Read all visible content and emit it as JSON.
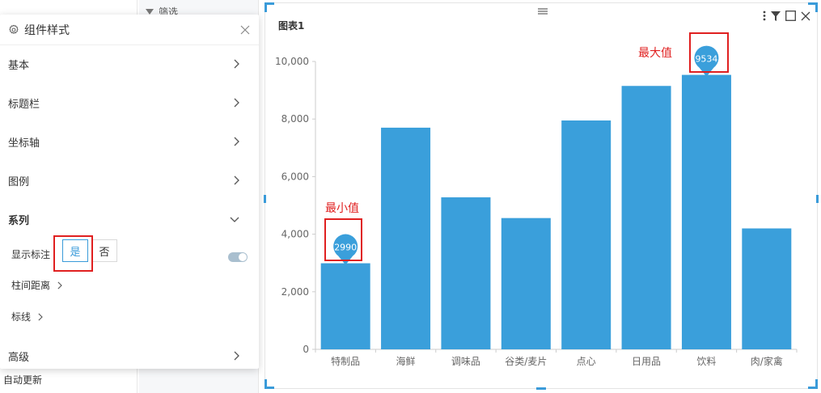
{
  "background": {
    "filter_label": "筛选",
    "auto_update_label": "自动更新"
  },
  "panel": {
    "title": "组件样式",
    "sections": [
      {
        "label": "基本"
      },
      {
        "label": "标题栏"
      },
      {
        "label": "坐标轴"
      },
      {
        "label": "图例"
      }
    ],
    "series_section": {
      "label": "系列",
      "show_labels": {
        "label": "显示标注",
        "options": [
          "是",
          "否"
        ],
        "selected": "是",
        "toggle_on": true
      },
      "bar_spacing_label": "柱间距离",
      "mark_line_label": "标线"
    },
    "advanced_label": "高级"
  },
  "chart_data": {
    "type": "bar",
    "title": "图表1",
    "categories": [
      "特制品",
      "海鲜",
      "调味品",
      "谷类/麦片",
      "点心",
      "日用品",
      "饮料",
      "肉/家禽"
    ],
    "values": [
      2990,
      7700,
      5280,
      4560,
      7950,
      9150,
      9534,
      4200
    ],
    "ylim": [
      0,
      10000
    ],
    "yticks": [
      0,
      2000,
      4000,
      6000,
      8000,
      10000
    ],
    "ytick_labels": [
      "0",
      "2,000",
      "4,000",
      "6,000",
      "8,000",
      "10,000"
    ],
    "bar_color": "#3a9fdb",
    "grid": false,
    "markers": [
      {
        "type": "min",
        "category": "特制品",
        "value": 2990,
        "label": "2990",
        "annotation": "最小值"
      },
      {
        "type": "max",
        "category": "饮料",
        "value": 9534,
        "label": "9534",
        "annotation": "最大值"
      }
    ]
  },
  "colors": {
    "accent": "#3a9bd9",
    "highlight_box": "#e02020"
  }
}
